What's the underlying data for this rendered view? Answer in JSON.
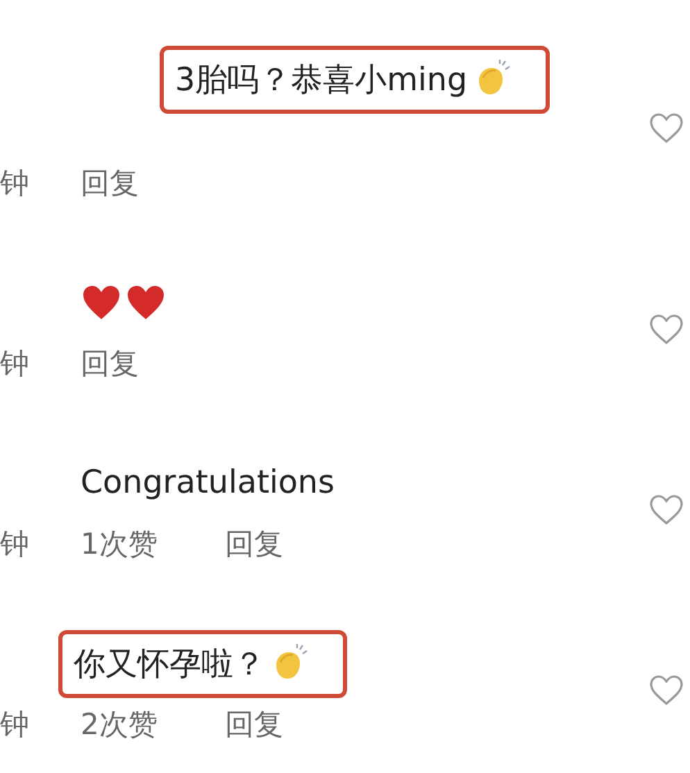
{
  "comments": [
    {
      "text": "3胎吗？恭喜小ming",
      "emoji": [
        {
          "kind": "clap"
        }
      ],
      "highlighted": true,
      "time": "钟",
      "reply": "回复"
    },
    {
      "emoji": [
        {
          "kind": "heart"
        },
        {
          "kind": "heart"
        }
      ],
      "highlighted": false,
      "time": "钟",
      "reply": "回复"
    },
    {
      "text": "Congratulations",
      "highlighted": false,
      "time": "钟",
      "likes": "1次赞",
      "reply": "回复"
    },
    {
      "text": "你又怀孕啦？",
      "emoji": [
        {
          "kind": "clap"
        }
      ],
      "highlighted": true,
      "time": "钟",
      "likes": "2次赞",
      "reply": "回复"
    }
  ]
}
